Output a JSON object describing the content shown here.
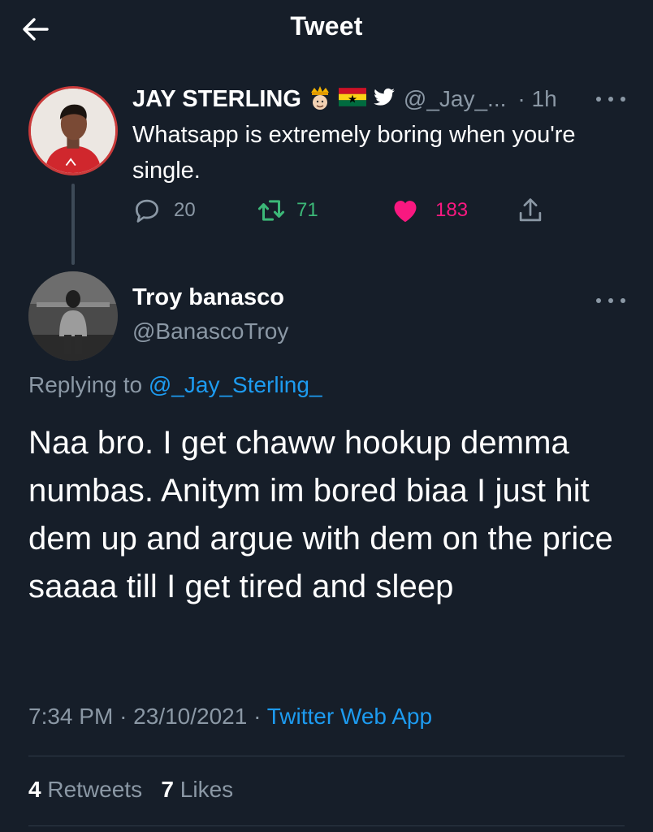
{
  "header": {
    "title": "Tweet",
    "back_icon": "arrow-left-icon"
  },
  "parent_tweet": {
    "name": "JAY STERLING",
    "badges": [
      "crown-emoji-icon",
      "ghana-flag-icon",
      "twitter-bird-icon"
    ],
    "handle": "@_Jay_...",
    "time": "· 1h",
    "text": "Whatsapp is extremely boring when you're single.",
    "replies": "20",
    "retweets": "71",
    "likes": "183"
  },
  "reply_tweet": {
    "name": "Troy banasco",
    "handle": "@BanascoTroy",
    "replying_prefix": "Replying to",
    "replying_handle": "@_Jay_Sterling_",
    "text": "Naa bro. I get chaww hookup demma numbas. Anitym im bored biaa I just hit dem up and argue with dem on the price saaaa till I get tired and sleep",
    "time": "7:34 PM",
    "date": "23/10/2021",
    "source": "Twitter Web App",
    "retweets_count": "4",
    "retweets_label": "Retweets",
    "likes_count": "7",
    "likes_label": "Likes"
  },
  "colors": {
    "background": "#161e29",
    "muted": "#8b98a5",
    "link": "#1d9bf0",
    "retweet_green": "#3cb878",
    "like_pink": "#f91880"
  }
}
